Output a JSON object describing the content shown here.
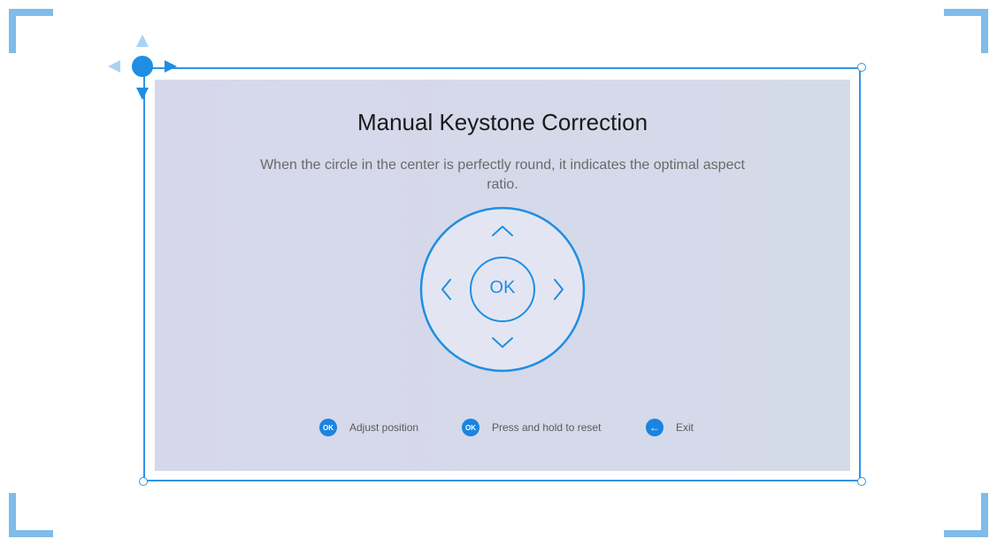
{
  "title": "Manual Keystone Correction",
  "description": "When the circle in the center is perfectly round, it indicates the optimal aspect ratio.",
  "dpad": {
    "center_label": "OK",
    "up_icon": "chevron-up-icon",
    "down_icon": "chevron-down-icon",
    "left_icon": "chevron-left-icon",
    "right_icon": "chevron-right-icon"
  },
  "hints": [
    {
      "badge": "OK",
      "label": "Adjust position",
      "icon": "ok-badge-icon"
    },
    {
      "badge": "OK",
      "label": "Press and hold to reset",
      "icon": "ok-badge-icon"
    },
    {
      "badge": "←",
      "label": "Exit",
      "icon": "back-arrow-icon"
    }
  ],
  "colors": {
    "accent": "#2f95e8",
    "corner_guides": "#7fbcea",
    "panel_left": "#d7d7ec",
    "panel_right": "#d3dbe8"
  }
}
